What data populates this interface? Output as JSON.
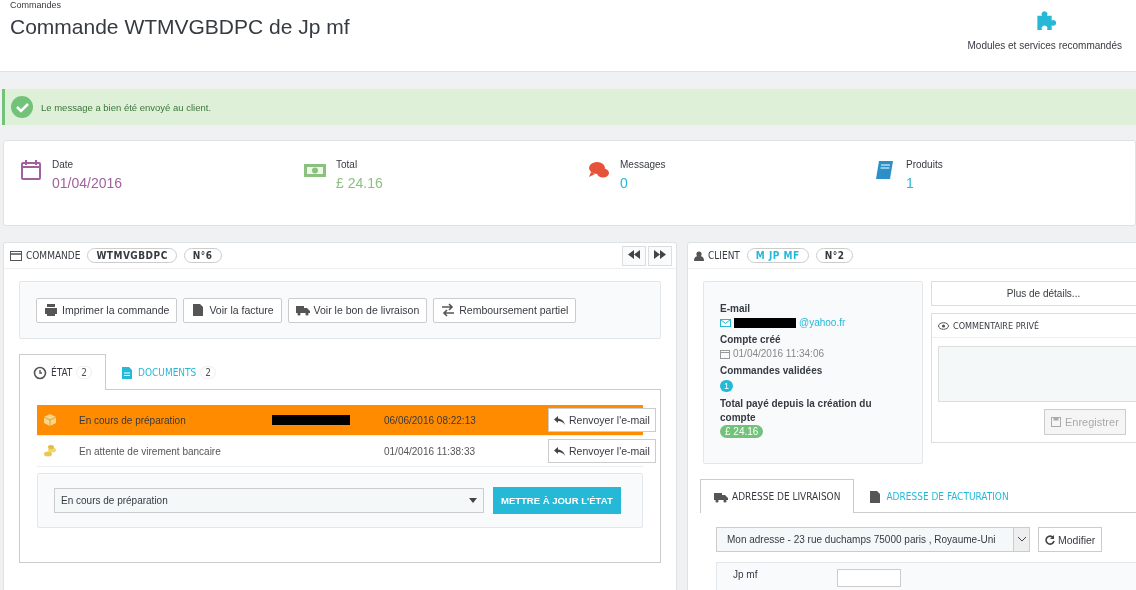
{
  "header": {
    "breadcrumb": "Commandes",
    "title": "Commande WTMVGBDPC de Jp mf",
    "action": "Modules et services recommandés"
  },
  "alert": {
    "message": "Le message a bien été envoyé au client."
  },
  "kpis": [
    {
      "kind": "date",
      "label": "Date",
      "value": "01/04/2016"
    },
    {
      "kind": "total",
      "label": "Total",
      "value": "£ 24.16"
    },
    {
      "kind": "messages",
      "label": "Messages",
      "value": "0"
    },
    {
      "kind": "products",
      "label": "Produits",
      "value": "1"
    }
  ],
  "order_panel": {
    "title": "COMMANDE",
    "reference": "WTMVGBDPC",
    "number": "N°6",
    "buttons": [
      {
        "kind": "print",
        "label": "Imprimer la commande"
      },
      {
        "kind": "invoice",
        "label": "Voir la facture"
      },
      {
        "kind": "delivery",
        "label": "Voir le bon de livraison"
      },
      {
        "kind": "refund",
        "label": "Remboursement partiel"
      }
    ],
    "tabs": [
      {
        "kind": "state",
        "label": "ÉTAT",
        "count": "2",
        "selected": true
      },
      {
        "kind": "documents",
        "label": "DOCUMENTS",
        "count": "2",
        "selected": false
      }
    ],
    "history": [
      {
        "kind": "package",
        "status": "En cours de préparation",
        "redacted": true,
        "date": "06/06/2016 08:22:13",
        "button": "Renvoyer l'e-mail",
        "current": true
      },
      {
        "kind": "coins",
        "status": "En attente de virement bancaire",
        "redacted": false,
        "date": "01/04/2016 11:38:33",
        "button": "Renvoyer l'e-mail",
        "current": false
      }
    ],
    "status_select": "En cours de préparation",
    "update_button": "METTRE À JOUR L'ÉTAT"
  },
  "client_panel": {
    "title": "CLIENT",
    "name": "M JP MF",
    "number": "N°2",
    "email_label": "E-mail",
    "email_suffix": "@yahoo.fr",
    "created_label": "Compte créé",
    "created_value": "01/04/2016 11:34:06",
    "validated_label": "Commandes validées",
    "validated_count": "1",
    "total_label": "Total payé depuis la création du compte",
    "total_value": "£ 24.16",
    "details_button": "Plus de détails...",
    "comment_title": "COMMENTAIRE PRIVÉ",
    "save_button": {
      "label": "Enregistrer",
      "disabled": true
    },
    "address_tabs": [
      {
        "kind": "delivery",
        "label": "ADRESSE DE LIVRAISON",
        "selected": true
      },
      {
        "kind": "invoice",
        "label": "ADRESSE DE FACTURATION",
        "selected": false
      }
    ],
    "address_select": "Mon adresse - 23 rue duchamps 75000 paris , Royaume-Uni",
    "modify_button": "Modifier",
    "address_name": "Jp mf"
  }
}
